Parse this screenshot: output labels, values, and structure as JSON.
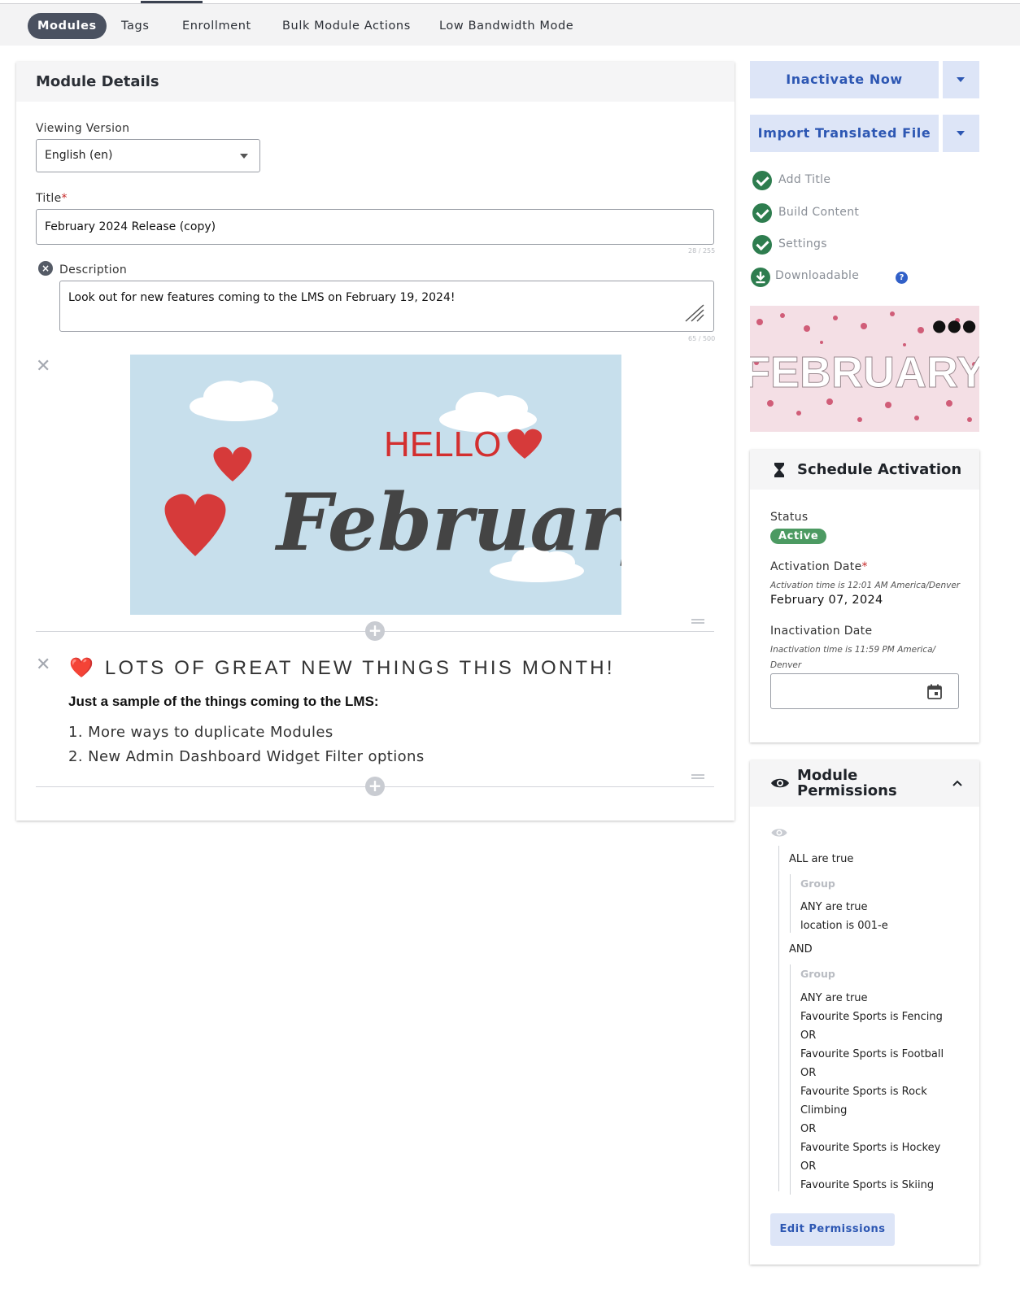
{
  "nav": {
    "tabs": [
      {
        "label": "Modules"
      },
      {
        "label": "Tags"
      },
      {
        "label": "Enrollment"
      },
      {
        "label": "Bulk Module Actions"
      },
      {
        "label": "Low Bandwidth Mode"
      }
    ]
  },
  "module_details": {
    "header": "Module Details",
    "viewing_version_label": "Viewing Version",
    "viewing_version_value": "English (en)",
    "title_label": "Title",
    "required_mark": "*",
    "title_value": "February 2024 Release (copy)",
    "title_counter": "28 / 255",
    "description_label": "Description",
    "description_value": "Look out for new features coming to the LMS on February 19, 2024!",
    "description_counter": "65 / 500"
  },
  "content": {
    "hero_image": {
      "hello": "HELLO",
      "script": "February"
    },
    "heading_icon": "❤️",
    "heading": "LOTS OF GREAT NEW THINGS THIS MONTH!",
    "subheading": "Just a sample of the things coming to the LMS:",
    "list_items": [
      "1. More ways to duplicate Modules",
      "2. New Admin Dashboard Widget Filter options"
    ]
  },
  "actions": {
    "inactivate_label": "Inactivate Now",
    "import_label": "Import Translated File"
  },
  "steps": [
    {
      "label": "Add Title",
      "icon": "check-circle-icon"
    },
    {
      "label": "Build Content",
      "icon": "check-circle-icon"
    },
    {
      "label": "Settings",
      "icon": "check-circle-icon"
    },
    {
      "label": "Downloadable",
      "icon": "download-circle-icon"
    }
  ],
  "thumbnail": {
    "text": "FEBRUARY"
  },
  "schedule": {
    "title": "Schedule Activation",
    "status_label": "Status",
    "status_value": "Active",
    "activation_label": "Activation Date",
    "activation_hint": "Activation time is 12:01 AM America/Denver",
    "activation_value": "February 07, 2024",
    "inactivation_label": "Inactivation Date",
    "inactivation_hint_1": "Inactivation time is 11:59 PM America/",
    "inactivation_hint_2": "Denver",
    "inactivation_value": ""
  },
  "permissions": {
    "title_1": "Module",
    "title_2": "Permissions",
    "root_rule": "ALL are true",
    "group1": {
      "label": "Group",
      "rule": "ANY are true",
      "conditions": [
        "location is 001-e"
      ]
    },
    "joiner": "AND",
    "group2": {
      "label": "Group",
      "rule": "ANY are true",
      "lines": [
        "Favourite Sports is Fencing",
        "OR",
        "Favourite Sports is Football",
        "OR",
        "Favourite Sports is Rock",
        "Climbing",
        "OR",
        "Favourite Sports is Hockey",
        "OR",
        "Favourite Sports is Skiing"
      ]
    },
    "edit_label": "Edit Permissions"
  },
  "colors": {
    "accent": "#2d57b3",
    "accent_bg": "#dde5f7",
    "success": "#2e7d4f",
    "active_pill": "#4c9a62",
    "required": "#c62828"
  }
}
